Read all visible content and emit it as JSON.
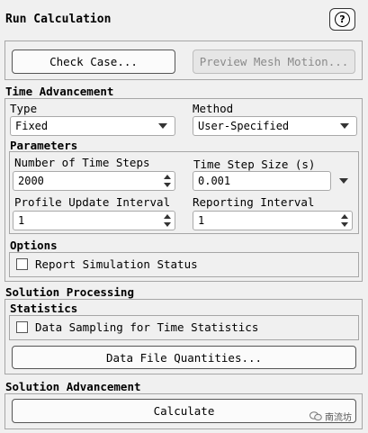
{
  "header": {
    "title": "Run Calculation",
    "help_icon": "question-circle-icon",
    "help_glyph": "?"
  },
  "actions": {
    "check_case": "Check Case...",
    "preview_mesh": "Preview Mesh Motion..."
  },
  "time_advancement": {
    "title": "Time Advancement",
    "type_label": "Type",
    "type_value": "Fixed",
    "method_label": "Method",
    "method_value": "User-Specified",
    "parameters_title": "Parameters",
    "num_steps_label": "Number of Time Steps",
    "num_steps_value": "2000",
    "step_size_label": "Time Step Size (s)",
    "step_size_value": "0.001",
    "profile_interval_label": "Profile Update Interval",
    "profile_interval_value": "1",
    "reporting_interval_label": "Reporting Interval",
    "reporting_interval_value": "1",
    "options_title": "Options",
    "report_status_label": "Report Simulation Status"
  },
  "solution_processing": {
    "title": "Solution Processing",
    "statistics_title": "Statistics",
    "data_sampling_label": "Data Sampling for Time Statistics",
    "data_file_button": "Data File Quantities..."
  },
  "solution_advancement": {
    "title": "Solution Advancement",
    "calculate_button": "Calculate"
  },
  "watermark": {
    "text": "南流坊",
    "icon": "wechat-icon"
  }
}
